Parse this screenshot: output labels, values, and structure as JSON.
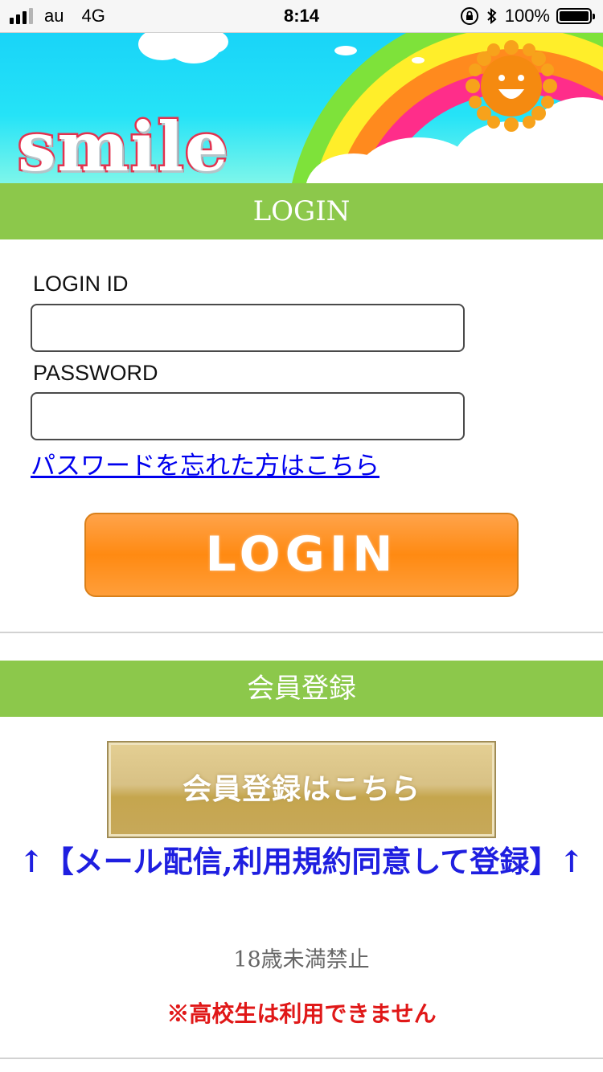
{
  "status_bar": {
    "carrier": "au",
    "network": "4G",
    "time": "8:14",
    "battery": "100%",
    "signal_bars_active": 3,
    "signal_bars_total": 4
  },
  "banner": {
    "logo": "smile"
  },
  "login_section": {
    "title": "LOGIN",
    "login_id_label": "LOGIN ID",
    "login_id_value": "",
    "password_label": "PASSWORD",
    "password_value": "",
    "forgot_password_link": "パスワードを忘れた方はこちら",
    "login_button": "LOGIN"
  },
  "register_section": {
    "title": "会員登録",
    "register_button": "会員登録はこちら",
    "agreement_note": "↑【メール配信,利用規約同意して登録】↑"
  },
  "notices": {
    "age_restriction": "18歳未満禁止",
    "high_school": "※高校生は利用できません"
  },
  "colors": {
    "section_header_bg": "#8cc84b",
    "login_button_bg": "#ff8a12",
    "register_button_bg": "#d8c185",
    "link": "#0000ee",
    "agreement_note": "#1f1fe0",
    "warning": "#e01818"
  }
}
